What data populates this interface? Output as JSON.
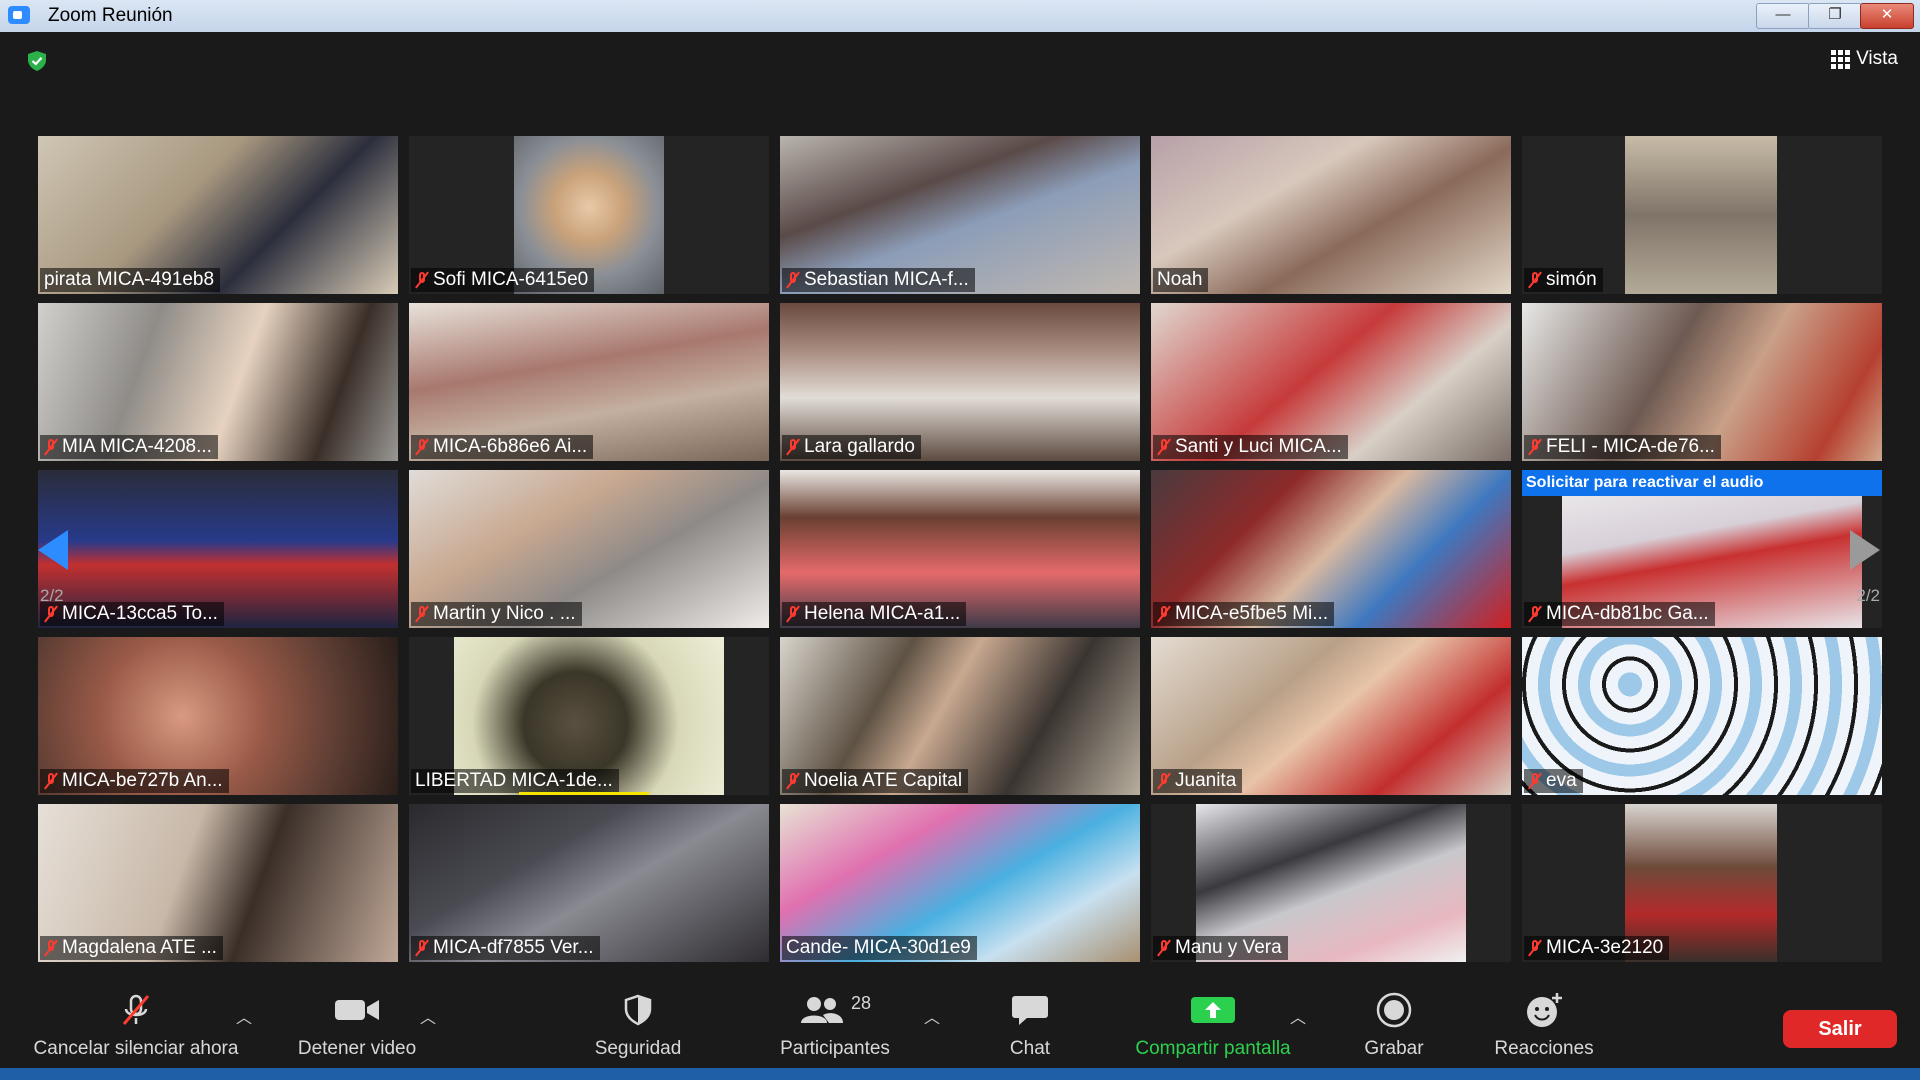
{
  "window": {
    "title": "Zoom Reunión",
    "minimize": "—",
    "restore": "❐",
    "close": "✕"
  },
  "header": {
    "view_label": "Vista"
  },
  "gallery": {
    "page_indicator_left": "2/2",
    "page_indicator_right": "2/2",
    "banner": "Solicitar para reactivar el audio",
    "tiles": [
      {
        "name": "pirata MICA-491eb8",
        "muted": false
      },
      {
        "name": "Sofi MICA-6415e0",
        "muted": true
      },
      {
        "name": "Sebastian MICA-f...",
        "muted": true
      },
      {
        "name": "Noah",
        "muted": false
      },
      {
        "name": "simón",
        "muted": true
      },
      {
        "name": "MIA   MICA-4208...",
        "muted": true
      },
      {
        "name": "MICA-6b86e6  Ai...",
        "muted": true
      },
      {
        "name": "Lara gallardo",
        "muted": true
      },
      {
        "name": "Santi y Luci MICA...",
        "muted": true
      },
      {
        "name": "FELI - MICA-de76...",
        "muted": true
      },
      {
        "name": "MICA-13cca5 To...",
        "muted": true
      },
      {
        "name": "Martin y Nico . ...",
        "muted": true
      },
      {
        "name": "Helena  MICA-a1...",
        "muted": true
      },
      {
        "name": "MICA-e5fbe5  Mi...",
        "muted": true
      },
      {
        "name": "MICA-db81bc Ga...",
        "muted": true
      },
      {
        "name": "MICA-be727b An...",
        "muted": true
      },
      {
        "name": "LIBERTAD MICA-1de...",
        "muted": false
      },
      {
        "name": "Noelia ATE Capital",
        "muted": true
      },
      {
        "name": "Juanita",
        "muted": true
      },
      {
        "name": "eva",
        "muted": true
      },
      {
        "name": "Magdalena ATE ...",
        "muted": true
      },
      {
        "name": "MICA-df7855 Ver...",
        "muted": true
      },
      {
        "name": "Cande- MICA-30d1e9",
        "muted": false
      },
      {
        "name": "Manu y Vera",
        "muted": true
      },
      {
        "name": "MICA-3e2120",
        "muted": true
      }
    ]
  },
  "toolbar": {
    "mute_label": "Cancelar silenciar ahora",
    "video_label": "Detener video",
    "security_label": "Seguridad",
    "participants_label": "Participantes",
    "participants_count": "28",
    "chat_label": "Chat",
    "share_label": "Compartir pantalla",
    "record_label": "Grabar",
    "reactions_label": "Reacciones",
    "leave_label": "Salir"
  },
  "colors": {
    "accent": "#2d8cff",
    "share_green": "#2bd14e",
    "leave_red": "#e02828",
    "muted_red": "#ff3b30",
    "speaking_yellow": "#f5e400"
  }
}
